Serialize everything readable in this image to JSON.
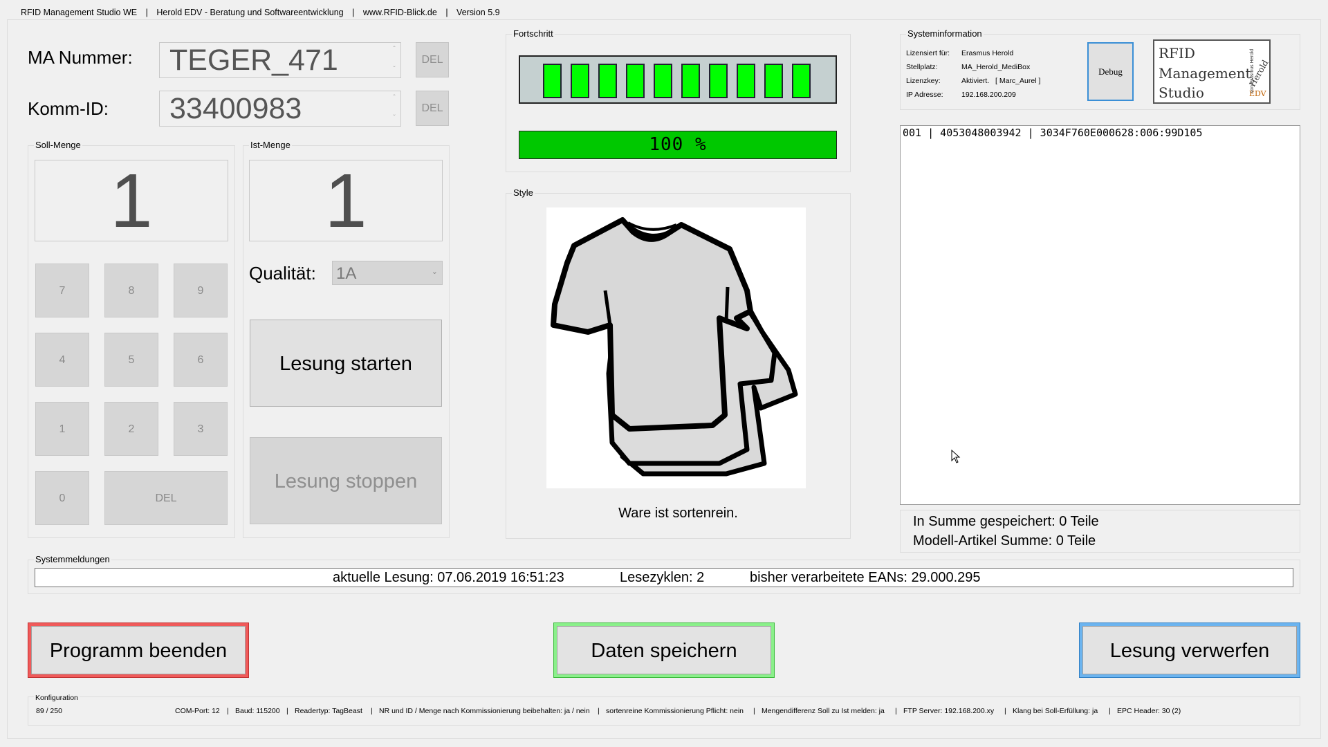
{
  "titlebar": {
    "app": "RFID Management Studio WE",
    "sep": "|",
    "company": "Herold EDV - Beratung und Softwareentwicklung",
    "web": "www.RFID-Blick.de",
    "version": "Version 5.9"
  },
  "ma": {
    "label": "MA Nummer:",
    "value": "TEGER_471",
    "del": "DEL"
  },
  "komm": {
    "label": "Komm-ID:",
    "value": "33400983",
    "del": "DEL"
  },
  "soll": {
    "title": "Soll-Menge",
    "value": "1"
  },
  "ist": {
    "title": "Ist-Menge",
    "value": "1"
  },
  "keypad": [
    "7",
    "8",
    "9",
    "4",
    "5",
    "6",
    "1",
    "2",
    "3",
    "0",
    "DEL"
  ],
  "quality": {
    "label": "Qualität:",
    "value": "1A"
  },
  "buttons": {
    "start": "Lesung starten",
    "stop": "Lesung stoppen"
  },
  "progress": {
    "title": "Fortschritt",
    "segments": 10,
    "percent_text": "100 %",
    "value": 1.0,
    "color": "#00ff00"
  },
  "style": {
    "title": "Style",
    "caption": "Ware ist sortenrein."
  },
  "sysinfo": {
    "title": "Systeminformation",
    "rows": [
      {
        "k": "Lizensiert für:",
        "v": "Erasmus Herold"
      },
      {
        "k": "Stellplatz:",
        "v": "MA_Herold_MediBox"
      },
      {
        "k": "Lizenzkey:",
        "v": "Aktiviert.   [ Marc_Aurel ]"
      },
      {
        "k": "IP Adresse:",
        "v": "192.168.200.209"
      }
    ],
    "debug": "Debug",
    "logo": {
      "line1": "RFID",
      "line2": "Management",
      "line3": "Studio",
      "brand": "Herold",
      "edv": "EDV",
      "side": "von Erasmus Herold"
    }
  },
  "log": {
    "line1": "001 | 4053048003942 | 3034F760E000628:006:99D105"
  },
  "summary": {
    "saved": "In Summe gespeichert: 0 Teile",
    "model": "Modell-Artikel Summe: 0 Teile"
  },
  "messages": {
    "title": "Systemmeldungen",
    "aktuelle": "aktuelle Lesung: 07.06.2019 16:51:23",
    "zyklen": "Lesezyklen: 2",
    "eans": "bisher verarbeitete EANs: 29.000.295"
  },
  "actions": {
    "exit": "Programm beenden",
    "save": "Daten speichern",
    "discard": "Lesung verwerfen"
  },
  "config": {
    "title": "Konfiguration",
    "count": "89 / 250",
    "items": [
      "COM-Port: 12",
      "Baud: 115200",
      "Readertyp: TagBeast",
      "NR und ID / Menge nach Kommissionierung beibehalten: ja / nein",
      "sortenreine Kommissionierung Pflicht: nein",
      "Mengendifferenz Soll zu Ist melden: ja",
      "FTP Server: 192.168.200.xy",
      "Klang bei Soll-Erfüllung: ja",
      "EPC Header: 30 (2)"
    ]
  }
}
